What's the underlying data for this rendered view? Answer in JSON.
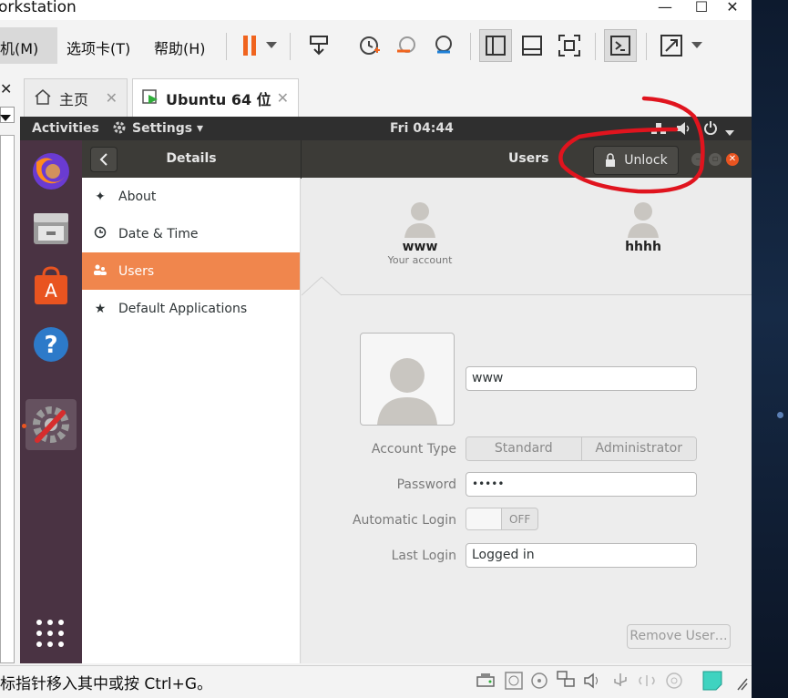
{
  "window": {
    "title": "orkstation"
  },
  "menu": {
    "vm": "虚拟机(M)",
    "vm_visible": "机(M)",
    "tabs": "选项卡(T)",
    "help": "帮助(H)"
  },
  "toolbar": {
    "icons": [
      "pause-icon",
      "send-keys-icon",
      "snapshot-icon",
      "revert-snapshot-icon",
      "manage-snapshots-icon",
      "library-view-icon",
      "console-view-icon",
      "fullscreen-icon",
      "terminal-icon",
      "stretch-icon"
    ]
  },
  "tabs": [
    {
      "label": "主页",
      "icon": "home-icon"
    },
    {
      "label": "Ubuntu 64 位",
      "icon": "vm-running-icon"
    }
  ],
  "ubuntu": {
    "topbar": {
      "activities": "Activities",
      "app_menu": "Settings ▾",
      "clock": "Fri 04:44"
    },
    "settings": {
      "panel_title": "Details",
      "page_title": "Users",
      "unlock_label": "Unlock",
      "nav": [
        {
          "label": "About",
          "icon": "star-sparkle-icon"
        },
        {
          "label": "Date & Time",
          "icon": "clock-icon"
        },
        {
          "label": "Users",
          "icon": "users-icon",
          "active": true
        },
        {
          "label": "Default Applications",
          "icon": "star-icon"
        }
      ],
      "users": [
        {
          "name": "www",
          "subtitle": "Your account"
        },
        {
          "name": "hhhh",
          "subtitle": ""
        }
      ],
      "form": {
        "username_value": "www",
        "account_type_label": "Account Type",
        "account_type_options": [
          "Standard",
          "Administrator"
        ],
        "password_label": "Password",
        "password_value": "•••••",
        "autologin_label": "Automatic Login",
        "autologin_state": "OFF",
        "last_login_label": "Last Login",
        "last_login_value": "Logged in",
        "remove_user_label": "Remove User…"
      }
    }
  },
  "statusbar": {
    "text": "标指针移入其中或按 Ctrl+G。"
  },
  "colors": {
    "accent": "#f0864d",
    "dock": "#4a3343",
    "annotation": "#e0141e"
  }
}
